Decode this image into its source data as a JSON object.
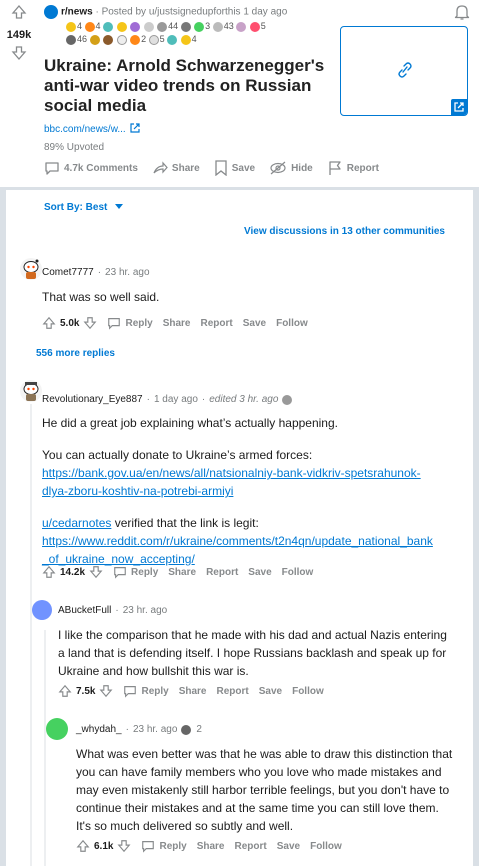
{
  "post": {
    "score": "149k",
    "subreddit": "r/news",
    "posted_by": "Posted by u/justsignedupforthis",
    "age": "1 day ago",
    "award_counts_row1": [
      "4",
      "4",
      "44",
      "3",
      "43",
      "5"
    ],
    "award_counts_row2": [
      "46",
      "2",
      "5",
      "4"
    ],
    "title": "Ukraine: Arnold Schwarzenegger's anti-war video trends on Russian social media",
    "link_text": "bbc.com/news/w...",
    "upvoted_text": "89% Upvoted",
    "comments_label": "4.7k Comments",
    "share_label": "Share",
    "save_label": "Save",
    "hide_label": "Hide",
    "report_label": "Report"
  },
  "sort": {
    "label": "Sort By: Best"
  },
  "other_discussions": "View discussions in 13 other communities",
  "comments": [
    {
      "user": "Comet7777",
      "time": "23 hr. ago",
      "body": "That was so well said.",
      "score": "5.0k"
    },
    {
      "more": "556 more replies"
    },
    {
      "user": "Revolutionary_Eye887",
      "time": "1 day ago",
      "edited": "edited 3 hr. ago",
      "p1": "He did a great job explaining what’s actually happening.",
      "p2": "You can actually donate to Ukraine’s armed forces:",
      "link1a": "https://bank.gov.ua/en/news/all/natsionalniy-bank-vidkriv-spetsrahunok-",
      "link1b": "dlya-zboru-koshtiv-na-potrebi-armiyi",
      "mention": "u/cedarnotes",
      "p3": " verified that the link is legit:",
      "link2a": "https://www.reddit.com/r/ukraine/comments/t2n4qn/update_national_bank",
      "link2b": "_of_ukraine_now_accepting/",
      "score": "14.2k"
    },
    {
      "user": "ABucketFull",
      "time": "23 hr. ago",
      "l1": "I like the comparison that he made with his dad and actual Nazis entering",
      "l2": "a land that is defending itself. I hope Russians backlash and speak up for",
      "l3": "Ukraine and how bullshit this war is.",
      "score": "7.5k"
    },
    {
      "user": "_whydah_",
      "time": "23 hr. ago",
      "award": "2",
      "l1": "What was even better was that he was able to draw this distinction that",
      "l2": "you can have family members who you love who made mistakes and",
      "l3": "may even mistakenly still harbor terrible feelings, but you don't have to",
      "l4": "continue their mistakes and at the same time you can still love them.",
      "l5": "It's so much delivered so subtly and well.",
      "score": "6.1k"
    }
  ],
  "actions": {
    "reply": "Reply",
    "share": "Share",
    "report": "Report",
    "save": "Save",
    "follow": "Follow"
  },
  "colors": {
    "accent": "#0079d3",
    "muted": "#878a8c",
    "page_bg": "#dae0e6"
  }
}
